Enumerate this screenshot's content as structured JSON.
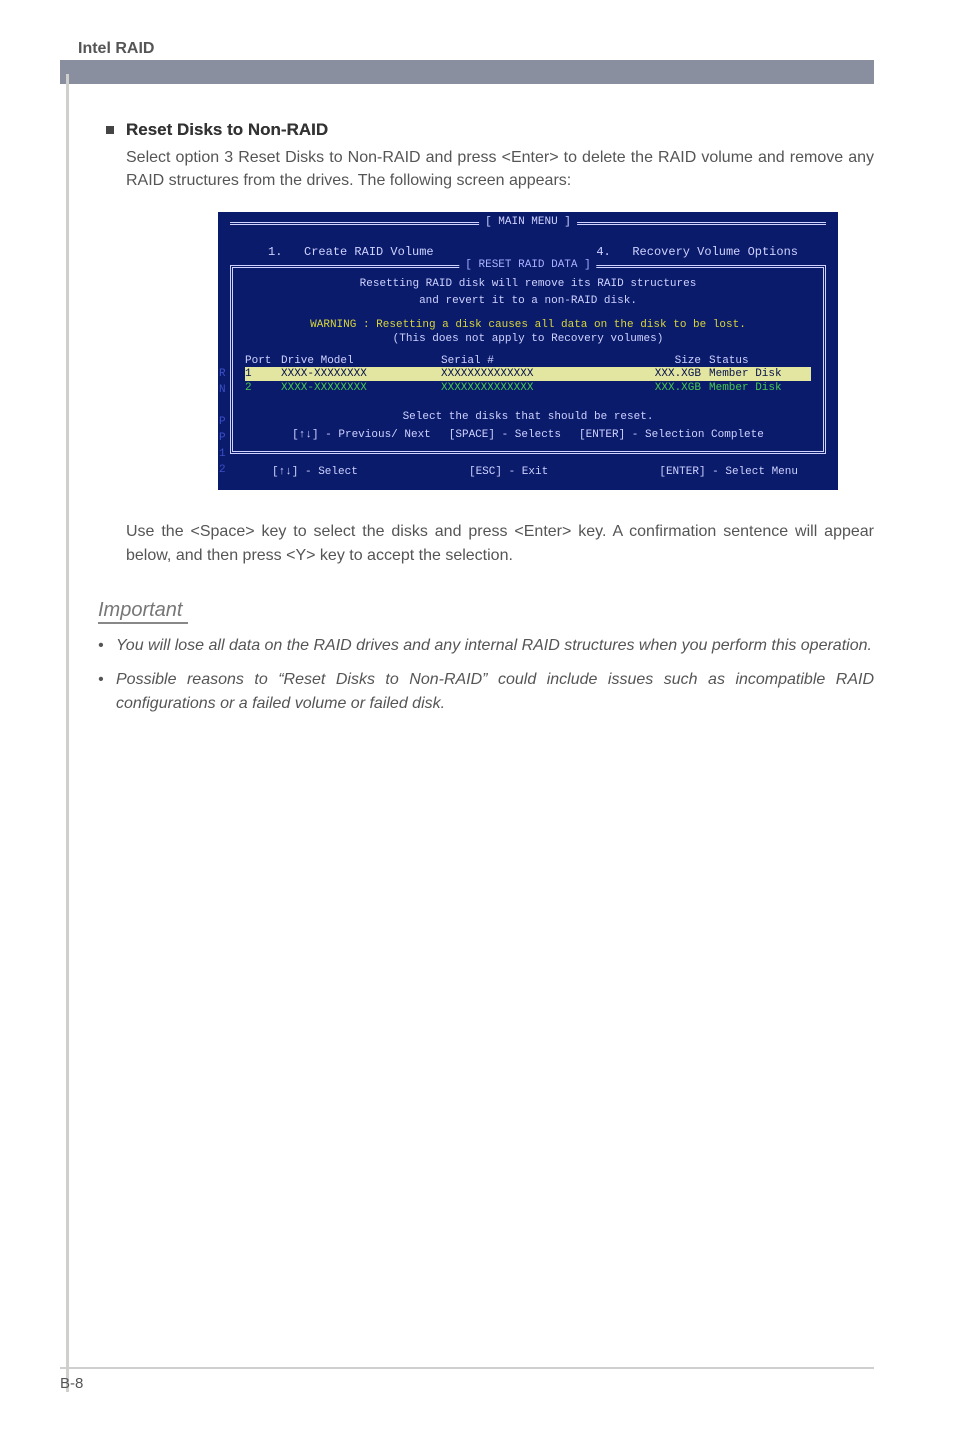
{
  "header": {
    "title": "Intel RAID"
  },
  "section": {
    "bullet_title": "Reset Disks to Non-RAID",
    "paragraph": "Select option 3 Reset Disks to Non-RAID and press <Enter> to delete the RAID volume and remove any RAID structures from the drives. The following screen appears:"
  },
  "bios": {
    "main_menu_label": "[    MAIN  MENU    ]",
    "mm_left_num": "1.",
    "mm_left_text": "Create  RAID  Volume",
    "mm_right_num": "4.",
    "mm_right_text": "Recovery Volume  Options",
    "reset_label": "[  RESET  RAID  DATA  ]",
    "msg_line1": "Resetting  RAID  disk  will  remove  its  RAID  structures",
    "msg_line2": "and  revert  it  to  a  non-RAID  disk.",
    "warn": "WARNING : Resetting  a  disk  causes  all  data  on  the  disk  to  be  lost.",
    "warn_sub": "(This  does  not  apply  to  Recovery  volumes)",
    "head": {
      "port": "Port",
      "drive": "Drive  Model",
      "serial": "Serial  #",
      "size": "Size",
      "status": "Status"
    },
    "rows": [
      {
        "port": "1",
        "model": "XXXX-XXXXXXXX",
        "serial": "XXXXXXXXXXXXXX",
        "size": "XXX.XGB",
        "status": "Member Disk"
      },
      {
        "port": "2",
        "model": "XXXX-XXXXXXXX",
        "serial": "XXXXXXXXXXXXXX",
        "size": "XXX.XGB",
        "status": "Member Disk"
      }
    ],
    "select_msg": "Select  the  disks  that  should  be  reset.",
    "keys": {
      "prev": "[↑↓] - Previous/ Next",
      "space": "[SPACE] - Selects",
      "enter": "[ENTER] - Selection Complete"
    },
    "bottom": {
      "sel": "[↑↓] - Select",
      "esc": "[ESC] - Exit",
      "menu": "[ENTER] - Select Menu"
    }
  },
  "after_para": "Use the <Space> key to select the disks and press <Enter> key. A confirmation sentence will appear below, and then press <Y> key to accept the selection.",
  "important": {
    "title": "Important",
    "items": [
      "You will lose all data on the RAID drives and any internal RAID structures when you perform this operation.",
      "Possible reasons to “Reset Disks to Non-RAID” could include issues such as incompatible RAID configurations or a failed volume or failed disk."
    ]
  },
  "footer": "B-8"
}
